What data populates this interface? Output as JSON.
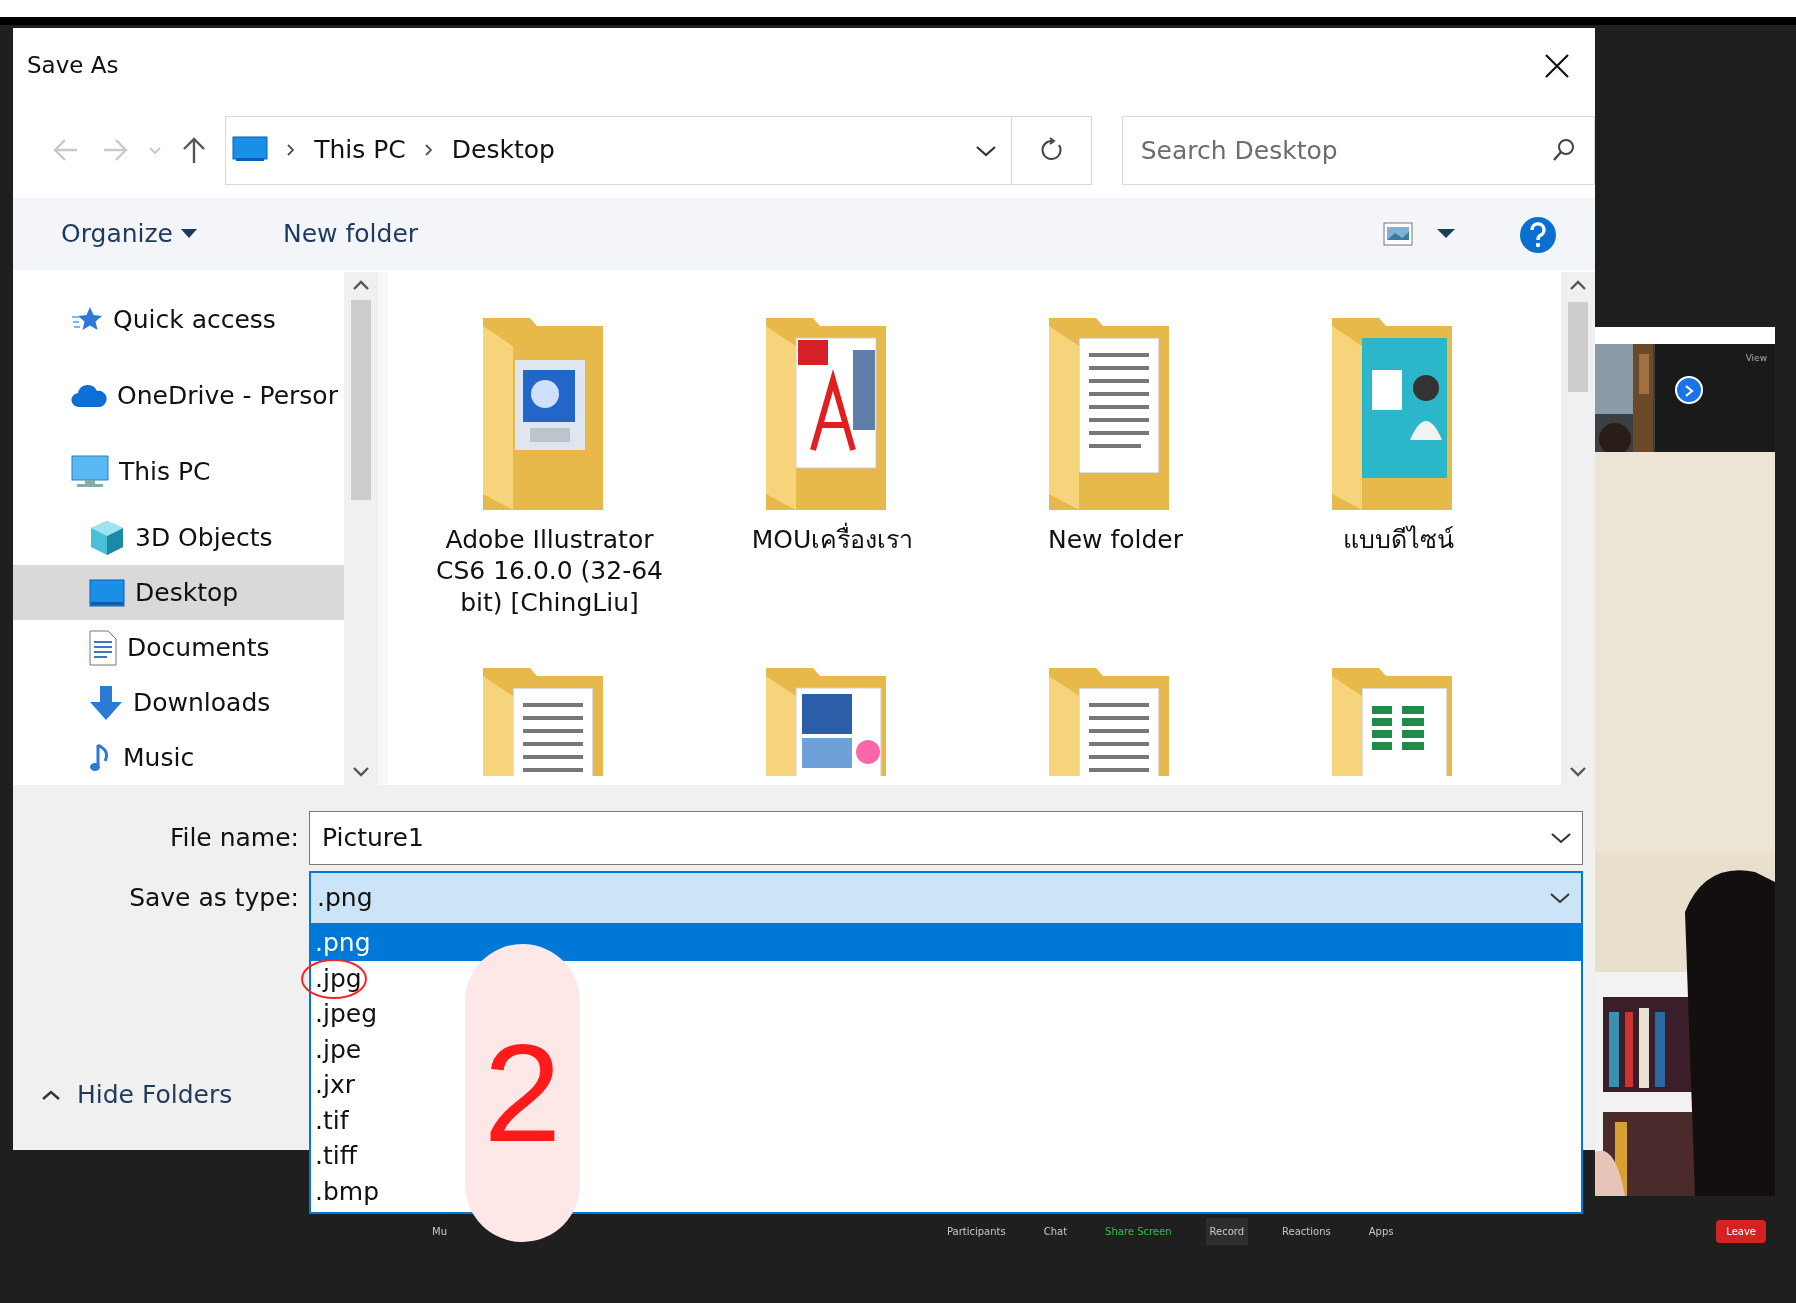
{
  "dialog": {
    "title": "Save As",
    "address": {
      "path": [
        "This PC",
        "Desktop"
      ]
    },
    "search": {
      "placeholder": "Search Desktop"
    },
    "toolbar": {
      "organize": "Organize",
      "new_folder": "New folder"
    },
    "nav": [
      {
        "label": "Quick access",
        "kind": "star",
        "selected": false
      },
      {
        "label": "OneDrive - Persor",
        "kind": "cloud",
        "selected": false
      },
      {
        "label": "This PC",
        "kind": "pc",
        "selected": false,
        "children": [
          {
            "label": "3D Objects",
            "kind": "cube",
            "selected": false
          },
          {
            "label": "Desktop",
            "kind": "desktop",
            "selected": true
          },
          {
            "label": "Documents",
            "kind": "document",
            "selected": false
          },
          {
            "label": "Downloads",
            "kind": "download",
            "selected": false
          },
          {
            "label": "Music",
            "kind": "music",
            "selected": false
          }
        ]
      }
    ],
    "files": [
      {
        "name": "Adobe Illustrator CS6 16.0.0 (32-64 bit) [ChingLiu]",
        "kind": "info"
      },
      {
        "name": "MOUเครื่องเรา",
        "kind": "pdf"
      },
      {
        "name": "New folder",
        "kind": "docs"
      },
      {
        "name": "แบบดีไซน์",
        "kind": "brochure"
      }
    ],
    "more_folders": [
      {
        "kind": "docs"
      },
      {
        "kind": "pictures"
      },
      {
        "kind": "docs"
      },
      {
        "kind": "sheet"
      }
    ],
    "file_name": {
      "label": "File name:",
      "value": "Picture1"
    },
    "save_as_type": {
      "label": "Save as type:",
      "value": ".png",
      "options": [
        {
          "label": ".png",
          "selected": true,
          "circled": false
        },
        {
          "label": ".jpg",
          "selected": false,
          "circled": true
        },
        {
          "label": ".jpeg",
          "selected": false,
          "circled": false
        },
        {
          "label": ".jpe",
          "selected": false,
          "circled": false
        },
        {
          "label": ".jxr",
          "selected": false,
          "circled": false
        },
        {
          "label": ".tif",
          "selected": false,
          "circled": false
        },
        {
          "label": ".tiff",
          "selected": false,
          "circled": false
        },
        {
          "label": ".bmp",
          "selected": false,
          "circled": false
        }
      ]
    },
    "hide_folders": "Hide Folders"
  },
  "meeting": {
    "view_label": "View",
    "toolbar": [
      {
        "label": "Mu",
        "color": "#c8c8c8",
        "active": false
      },
      {
        "label": "Participants",
        "color": "#c8c8c8",
        "active": false
      },
      {
        "label": "Chat",
        "color": "#c8c8c8",
        "active": false
      },
      {
        "label": "Share Screen",
        "color": "#2fbf4a",
        "active": false
      },
      {
        "label": "Record",
        "color": "#c8c8c8",
        "active": true
      },
      {
        "label": "Reactions",
        "color": "#c8c8c8",
        "active": false
      },
      {
        "label": "Apps",
        "color": "#c8c8c8",
        "active": false
      }
    ],
    "leave": "Leave"
  },
  "annotation": {
    "step": "2"
  }
}
